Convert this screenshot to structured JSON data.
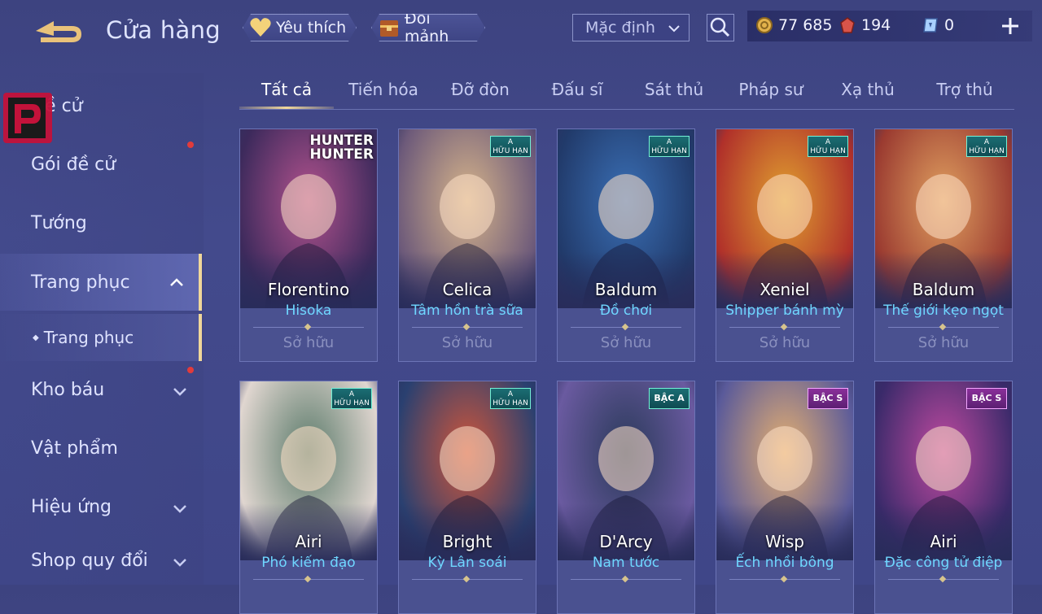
{
  "header": {
    "title": "Cửa hàng",
    "favorites_label": "Yêu thích",
    "exchange_label": "Đổi mảnh",
    "sort_select": "Mặc định",
    "currencies": [
      {
        "name": "gold",
        "value": "77 685"
      },
      {
        "name": "ruby",
        "value": "194"
      },
      {
        "name": "voucher",
        "value": "0"
      }
    ]
  },
  "sidebar": {
    "items": [
      {
        "label": "Đề cử"
      },
      {
        "label": "Gói đề cử"
      },
      {
        "label": "Tướng"
      },
      {
        "label": "Trang phục"
      },
      {
        "label": "Trang phục"
      },
      {
        "label": "Kho báu"
      },
      {
        "label": "Vật phẩm"
      },
      {
        "label": "Hiệu ứng"
      },
      {
        "label": "Shop quy đổi"
      }
    ]
  },
  "tabs": [
    "Tất cả",
    "Tiến hóa",
    "Đỡ đòn",
    "Đấu sĩ",
    "Sát thủ",
    "Pháp sư",
    "Xạ thủ",
    "Trợ thủ"
  ],
  "cards": [
    {
      "hero": "Florentino",
      "skin": "Hisoka",
      "status": "Sở hữu",
      "badge": "",
      "logo": "HUNTER\nHUNTER",
      "colors": [
        "#b2528d",
        "#3d2a5c"
      ]
    },
    {
      "hero": "Celica",
      "skin": "Tâm hồn trà sữa",
      "status": "Sở hữu",
      "badge": "A\nHỮU HẠN",
      "colors": [
        "#d6b48a",
        "#6d5a7a"
      ]
    },
    {
      "hero": "Baldum",
      "skin": "Đồ chơi",
      "status": "Sở hữu",
      "badge": "A\nHỮU HẠN",
      "colors": [
        "#3a6fb5",
        "#213a6a"
      ]
    },
    {
      "hero": "Xeniel",
      "skin": "Shipper bánh mỳ",
      "status": "Sở hữu",
      "badge": "A\nHỮU HẠN",
      "colors": [
        "#e0a030",
        "#b0302a"
      ]
    },
    {
      "hero": "Baldum",
      "skin": "Thế giới kẹo ngọt",
      "status": "Sở hữu",
      "badge": "A\nHỮU HẠN",
      "colors": [
        "#e0a060",
        "#9a3a30"
      ]
    },
    {
      "hero": "Airi",
      "skin": "Phó kiếm đạo",
      "status": "",
      "badge": "A\nHỮU HẠN",
      "colors": [
        "#5a7a6a",
        "#e0d6d0"
      ]
    },
    {
      "hero": "Bright",
      "skin": "Kỳ Lân soái",
      "status": "",
      "badge": "A\nHỮU HẠN",
      "colors": [
        "#d0563a",
        "#2a4070"
      ]
    },
    {
      "hero": "D'Arcy",
      "skin": "Nam tước",
      "status": "",
      "badge": "BẬC A",
      "colors": [
        "#2a3a5a",
        "#6a5aa0"
      ]
    },
    {
      "hero": "Wisp",
      "skin": "Ếch nhồi bông",
      "status": "",
      "badge": "BẬC S",
      "colors": [
        "#e6b070",
        "#5a5a9a"
      ]
    },
    {
      "hero": "Airi",
      "skin": "Đặc công tử điệp",
      "status": "",
      "badge": "BẬC S",
      "colors": [
        "#c04aa0",
        "#3a2a6a"
      ]
    }
  ]
}
